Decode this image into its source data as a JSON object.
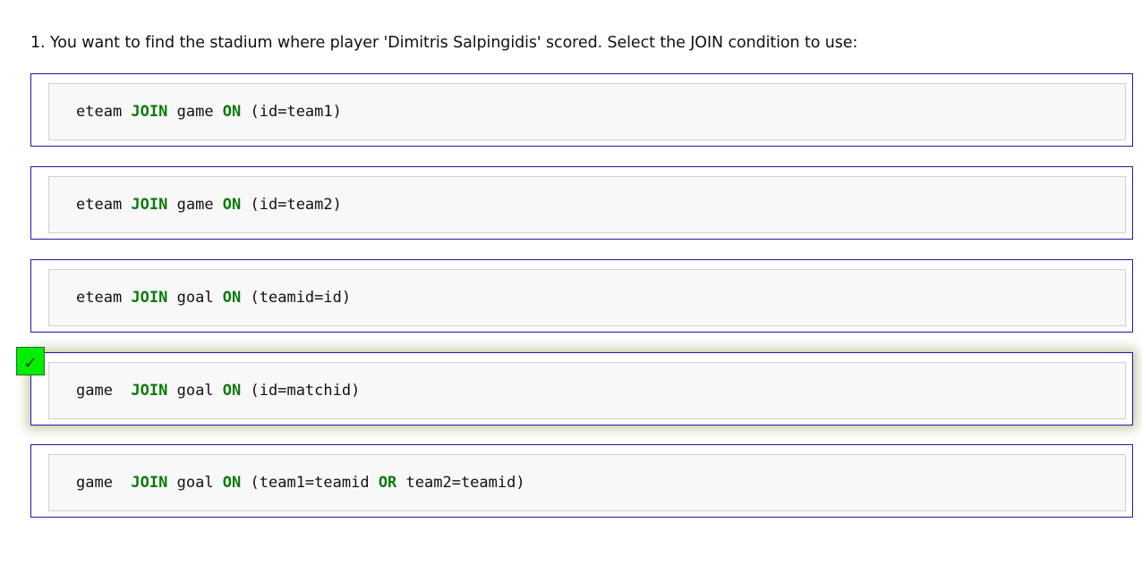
{
  "question": {
    "text": "1. You want to find the stadium where player 'Dimitris Salpingidis' scored. Select the JOIN condition to use:"
  },
  "options": [
    {
      "selected": false,
      "tokens": [
        {
          "t": "eteam ",
          "kw": false
        },
        {
          "t": "JOIN",
          "kw": true
        },
        {
          "t": " game ",
          "kw": false
        },
        {
          "t": "ON",
          "kw": true
        },
        {
          "t": " (id=team1)",
          "kw": false
        }
      ]
    },
    {
      "selected": false,
      "tokens": [
        {
          "t": "eteam ",
          "kw": false
        },
        {
          "t": "JOIN",
          "kw": true
        },
        {
          "t": " game ",
          "kw": false
        },
        {
          "t": "ON",
          "kw": true
        },
        {
          "t": " (id=team2)",
          "kw": false
        }
      ]
    },
    {
      "selected": false,
      "tokens": [
        {
          "t": "eteam ",
          "kw": false
        },
        {
          "t": "JOIN",
          "kw": true
        },
        {
          "t": " goal ",
          "kw": false
        },
        {
          "t": "ON",
          "kw": true
        },
        {
          "t": " (teamid=id)",
          "kw": false
        }
      ]
    },
    {
      "selected": true,
      "tokens": [
        {
          "t": "game  ",
          "kw": false
        },
        {
          "t": "JOIN",
          "kw": true
        },
        {
          "t": " goal ",
          "kw": false
        },
        {
          "t": "ON",
          "kw": true
        },
        {
          "t": " (id=matchid)",
          "kw": false
        }
      ]
    },
    {
      "selected": false,
      "tokens": [
        {
          "t": "game  ",
          "kw": false
        },
        {
          "t": "JOIN",
          "kw": true
        },
        {
          "t": " goal ",
          "kw": false
        },
        {
          "t": "ON",
          "kw": true
        },
        {
          "t": " (team1=teamid ",
          "kw": false
        },
        {
          "t": "OR",
          "kw": true
        },
        {
          "t": " team2=teamid)",
          "kw": false
        }
      ]
    }
  ],
  "check_mark": "✓",
  "colors": {
    "keyword": "#0a7a0a",
    "option_border": "#1a1aa6",
    "check_bg": "#00ee00"
  }
}
